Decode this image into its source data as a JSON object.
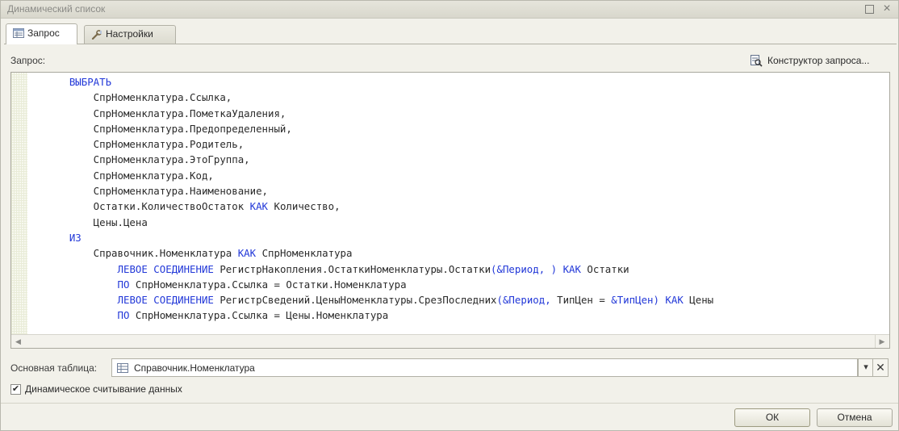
{
  "window": {
    "title": "Динамический список"
  },
  "tabs": [
    {
      "label": "Запрос",
      "icon": "query-tab-icon",
      "active": true
    },
    {
      "label": "Настройки",
      "icon": "settings-wrench-icon",
      "active": false
    }
  ],
  "query": {
    "label": "Запрос:",
    "constructor_button": "Конструктор запроса...",
    "lines": [
      {
        "segments": [
          {
            "t": "    ",
            "c": ""
          },
          {
            "t": "ВЫБРАТЬ",
            "c": "kw"
          }
        ]
      },
      {
        "segments": [
          {
            "t": "        СпрНоменклатура.Ссылка,",
            "c": ""
          }
        ]
      },
      {
        "segments": [
          {
            "t": "        СпрНоменклатура.ПометкаУдаления,",
            "c": ""
          }
        ]
      },
      {
        "segments": [
          {
            "t": "        СпрНоменклатура.Предопределенный,",
            "c": ""
          }
        ]
      },
      {
        "segments": [
          {
            "t": "        СпрНоменклатура.Родитель,",
            "c": ""
          }
        ]
      },
      {
        "segments": [
          {
            "t": "        СпрНоменклатура.ЭтоГруппа,",
            "c": ""
          }
        ]
      },
      {
        "segments": [
          {
            "t": "        СпрНоменклатура.Код,",
            "c": ""
          }
        ]
      },
      {
        "segments": [
          {
            "t": "        СпрНоменклатура.Наименование,",
            "c": ""
          }
        ]
      },
      {
        "segments": [
          {
            "t": "        Остатки.КоличествоОстаток ",
            "c": ""
          },
          {
            "t": "КАК",
            "c": "kw"
          },
          {
            "t": " Количество,",
            "c": ""
          }
        ]
      },
      {
        "segments": [
          {
            "t": "        Цены.Цена",
            "c": ""
          }
        ]
      },
      {
        "segments": [
          {
            "t": "    ",
            "c": ""
          },
          {
            "t": "ИЗ",
            "c": "kw"
          }
        ]
      },
      {
        "segments": [
          {
            "t": "        Справочник.Номенклатура ",
            "c": ""
          },
          {
            "t": "КАК",
            "c": "kw"
          },
          {
            "t": " СпрНоменклатура",
            "c": ""
          }
        ]
      },
      {
        "segments": [
          {
            "t": "            ",
            "c": ""
          },
          {
            "t": "ЛЕВОЕ СОЕДИНЕНИЕ",
            "c": "kw"
          },
          {
            "t": " РегистрНакопления.ОстаткиНоменклатуры.Остатки",
            "c": ""
          },
          {
            "t": "(&Период, )",
            "c": "par"
          },
          {
            "t": " ",
            "c": ""
          },
          {
            "t": "КАК",
            "c": "kw"
          },
          {
            "t": " Остатки",
            "c": ""
          }
        ]
      },
      {
        "segments": [
          {
            "t": "            ",
            "c": ""
          },
          {
            "t": "ПО",
            "c": "kw"
          },
          {
            "t": " СпрНоменклатура.Ссылка = Остатки.Номенклатура",
            "c": ""
          }
        ]
      },
      {
        "segments": [
          {
            "t": "            ",
            "c": ""
          },
          {
            "t": "ЛЕВОЕ СОЕДИНЕНИЕ",
            "c": "kw"
          },
          {
            "t": " РегистрСведений.ЦеныНоменклатуры.СрезПоследних",
            "c": ""
          },
          {
            "t": "(&Период,",
            "c": "par"
          },
          {
            "t": " ТипЦен = ",
            "c": ""
          },
          {
            "t": "&ТипЦен)",
            "c": "par"
          },
          {
            "t": " ",
            "c": ""
          },
          {
            "t": "КАК",
            "c": "kw"
          },
          {
            "t": " Цены",
            "c": ""
          }
        ]
      },
      {
        "segments": [
          {
            "t": "            ",
            "c": ""
          },
          {
            "t": "ПО",
            "c": "kw"
          },
          {
            "t": " СпрНоменклатура.Ссылка = Цены.Номенклатура",
            "c": ""
          }
        ]
      }
    ]
  },
  "main_table": {
    "label": "Основная таблица:",
    "value": "Справочник.Номенклатура"
  },
  "dynamic_read": {
    "label": "Динамическое считывание данных",
    "checked": true,
    "check_mark": "✔"
  },
  "buttons": {
    "ok": "ОК",
    "cancel": "Отмена"
  },
  "glyphs": {
    "close": "×",
    "dropdown": "▾",
    "clear": "✕",
    "scroll_left": "◀",
    "scroll_right": "▶"
  },
  "colors": {
    "keyword": "#2238d8",
    "window_bg": "#f2f1ea"
  }
}
